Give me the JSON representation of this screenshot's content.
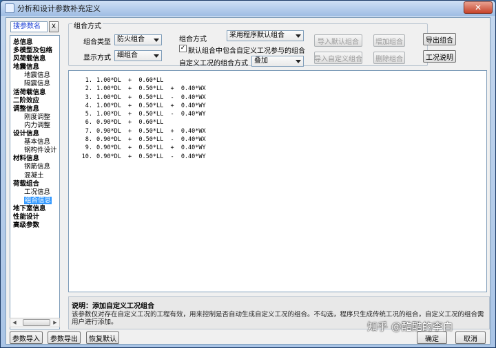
{
  "window": {
    "title": "分析和设计参数补充定义",
    "close_glyph": "✕"
  },
  "search": {
    "value": "搜参数名",
    "clear_label": "X"
  },
  "tree": [
    {
      "label": "总信息",
      "level": 0
    },
    {
      "label": "多模型及包络",
      "level": 0
    },
    {
      "label": "风荷载信息",
      "level": 0
    },
    {
      "label": "地震信息",
      "level": 0
    },
    {
      "label": "地震信息",
      "level": 1
    },
    {
      "label": "隔震信息",
      "level": 1
    },
    {
      "label": "活荷载信息",
      "level": 0
    },
    {
      "label": "二阶效应",
      "level": 0
    },
    {
      "label": "调整信息",
      "level": 0
    },
    {
      "label": "刚度调整",
      "level": 1
    },
    {
      "label": "内力调整",
      "level": 1
    },
    {
      "label": "设计信息",
      "level": 0
    },
    {
      "label": "基本信息",
      "level": 1
    },
    {
      "label": "钢构件设计",
      "level": 1
    },
    {
      "label": "材料信息",
      "level": 0
    },
    {
      "label": "钢筋信息",
      "level": 1
    },
    {
      "label": "混凝土",
      "level": 1
    },
    {
      "label": "荷载组合",
      "level": 0
    },
    {
      "label": "工况信息",
      "level": 1
    },
    {
      "label": "组合信息",
      "level": 1,
      "selected": true
    },
    {
      "label": "地下室信息",
      "level": 0
    },
    {
      "label": "性能设计",
      "level": 0
    },
    {
      "label": "高级参数",
      "level": 0
    }
  ],
  "group": {
    "title": "组合方式",
    "combo_type_label": "组合类型",
    "combo_type_value": "防火组合",
    "display_label": "显示方式",
    "display_value": "细组合",
    "method_label": "组合方式",
    "method_value": "采用程序默认组合",
    "default_include_label": "默认组合中包含自定义工况参与的组合",
    "default_include_checked": "✓",
    "custom_method_label": "自定义工况的组合方式",
    "custom_method_value": "叠加"
  },
  "buttons": {
    "import_default": "导入默认组合",
    "add_combo": "增加组合",
    "import_custom": "导入自定义组合",
    "delete_combo": "删除组合",
    "export_combo": "导出组合",
    "case_desc": "工况说明",
    "params_import": "参数导入",
    "params_export": "参数导出",
    "restore_default": "恢复默认",
    "ok": "确定",
    "cancel": "取消"
  },
  "combinations": [
    {
      "num": "1.",
      "expr": "1.00*DL  +  0.60*LL"
    },
    {
      "num": "2.",
      "expr": "1.00*DL  +  0.50*LL  +  0.40*WX"
    },
    {
      "num": "3.",
      "expr": "1.00*DL  +  0.50*LL  -  0.40*WX"
    },
    {
      "num": "4.",
      "expr": "1.00*DL  +  0.50*LL  +  0.40*WY"
    },
    {
      "num": "5.",
      "expr": "1.00*DL  +  0.50*LL  -  0.40*WY"
    },
    {
      "num": "6.",
      "expr": "0.90*DL  +  0.60*LL"
    },
    {
      "num": "7.",
      "expr": "0.90*DL  +  0.50*LL  +  0.40*WX"
    },
    {
      "num": "8.",
      "expr": "0.90*DL  +  0.50*LL  -  0.40*WX"
    },
    {
      "num": "9.",
      "expr": "0.90*DL  +  0.50*LL  +  0.40*WY"
    },
    {
      "num": "10.",
      "expr": "0.90*DL  +  0.50*LL  -  0.40*WY"
    }
  ],
  "description": {
    "title": "说明：添加自定义工况组合",
    "text": "该参数仅对存在自定义工况的工程有效，用来控制是否自动生成自定义工况的组合。不勾选，程序只生成传统工况的组合，自定义工况的组合需用户进行添加。"
  },
  "watermark": "知乎 @酷酷的李白",
  "colors": {
    "selection": "#3399ff",
    "search_text": "#1a3fd6"
  }
}
